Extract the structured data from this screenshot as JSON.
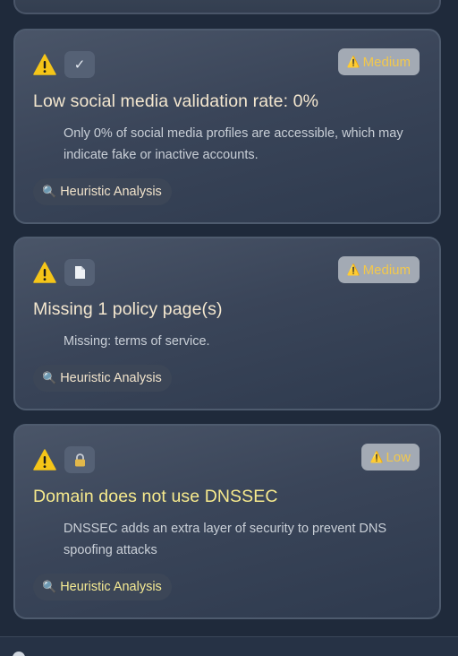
{
  "findings": [
    {
      "severity_label": "Medium",
      "severity_icon": "warning-icon",
      "category_icon": "checkmark-icon",
      "category_glyph": "✓",
      "title": "Low social media validation rate: 0%",
      "description": "Only 0% of social media profiles are accessible, which may indicate fake or inactive accounts.",
      "source": "Heuristic Analysis"
    },
    {
      "severity_label": "Medium",
      "severity_icon": "warning-icon",
      "category_icon": "document-icon",
      "category_glyph": "📄",
      "title": "Missing 1 policy page(s)",
      "description": "Missing: terms of service.",
      "source": "Heuristic Analysis"
    },
    {
      "severity_label": "Low",
      "severity_icon": "warning-icon",
      "category_icon": "lock-icon",
      "category_glyph": "🔒",
      "title": "Domain does not use DNSSEC",
      "description": "DNSSEC adds an extra layer of security to prevent DNS spoofing attacks",
      "source": "Heuristic Analysis"
    }
  ],
  "colors": {
    "background": "#1f2a3b",
    "badge_bg": "#a3aab4",
    "badge_text": "#f3c84b",
    "title_text": "#f4e7cf",
    "title_text_low": "#f7ea8d",
    "warning_yellow": "#f5c518"
  }
}
